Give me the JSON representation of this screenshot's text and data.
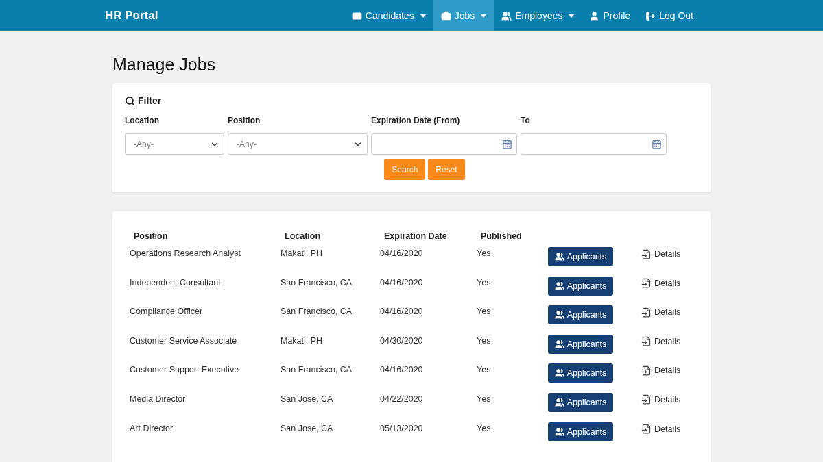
{
  "navbar": {
    "brand": "HR Portal",
    "items": [
      {
        "label": "Candidates",
        "dropdown": true,
        "selected": false
      },
      {
        "label": "Jobs",
        "dropdown": true,
        "selected": true
      },
      {
        "label": "Employees",
        "dropdown": true,
        "selected": false
      },
      {
        "label": "Profile",
        "dropdown": false,
        "selected": false
      },
      {
        "label": "Log Out",
        "dropdown": false,
        "selected": false
      }
    ]
  },
  "title": "Manage Jobs",
  "filter": {
    "title": "Filter",
    "fields": [
      {
        "label": "Location",
        "kind": "select",
        "value": "-Any-"
      },
      {
        "label": "Position",
        "kind": "select",
        "value": "-Any-"
      },
      {
        "label": "Expiration Date (From)",
        "kind": "date"
      },
      {
        "label": "To",
        "kind": "date"
      }
    ],
    "buttons": [
      "Search",
      "Reset"
    ]
  },
  "table": {
    "columns": [
      "Position",
      "Location",
      "Expiration Date",
      "Published"
    ],
    "rows": [
      {
        "position": "Operations Research Analyst",
        "location": "Makati, PH",
        "expiration": "04/16/2020",
        "published": "Yes",
        "applicants": "Applicants",
        "details": "Details"
      },
      {
        "position": "Independent Consultant",
        "location": "San Francisco, CA",
        "expiration": "04/16/2020",
        "published": "Yes",
        "applicants": "Applicants",
        "details": "Details"
      },
      {
        "position": "Compliance Officer",
        "location": "San Francisco, CA",
        "expiration": "04/16/2020",
        "published": "Yes",
        "applicants": "Applicants",
        "details": "Details"
      },
      {
        "position": "Customer Service Associate",
        "location": "Makati, PH",
        "expiration": "04/30/2020",
        "published": "Yes",
        "applicants": "Applicants",
        "details": "Details"
      },
      {
        "position": "Customer Support Executive",
        "location": "San Francisco, CA",
        "expiration": "04/16/2020",
        "published": "Yes",
        "applicants": "Applicants",
        "details": "Details"
      },
      {
        "position": "Media Director",
        "location": "San Jose, CA",
        "expiration": "04/22/2020",
        "published": "Yes",
        "applicants": "Applicants",
        "details": "Details"
      },
      {
        "position": "Art Director",
        "location": "San Jose, CA",
        "expiration": "05/13/2020",
        "published": "Yes",
        "applicants": "Applicants",
        "details": "Details"
      }
    ]
  }
}
